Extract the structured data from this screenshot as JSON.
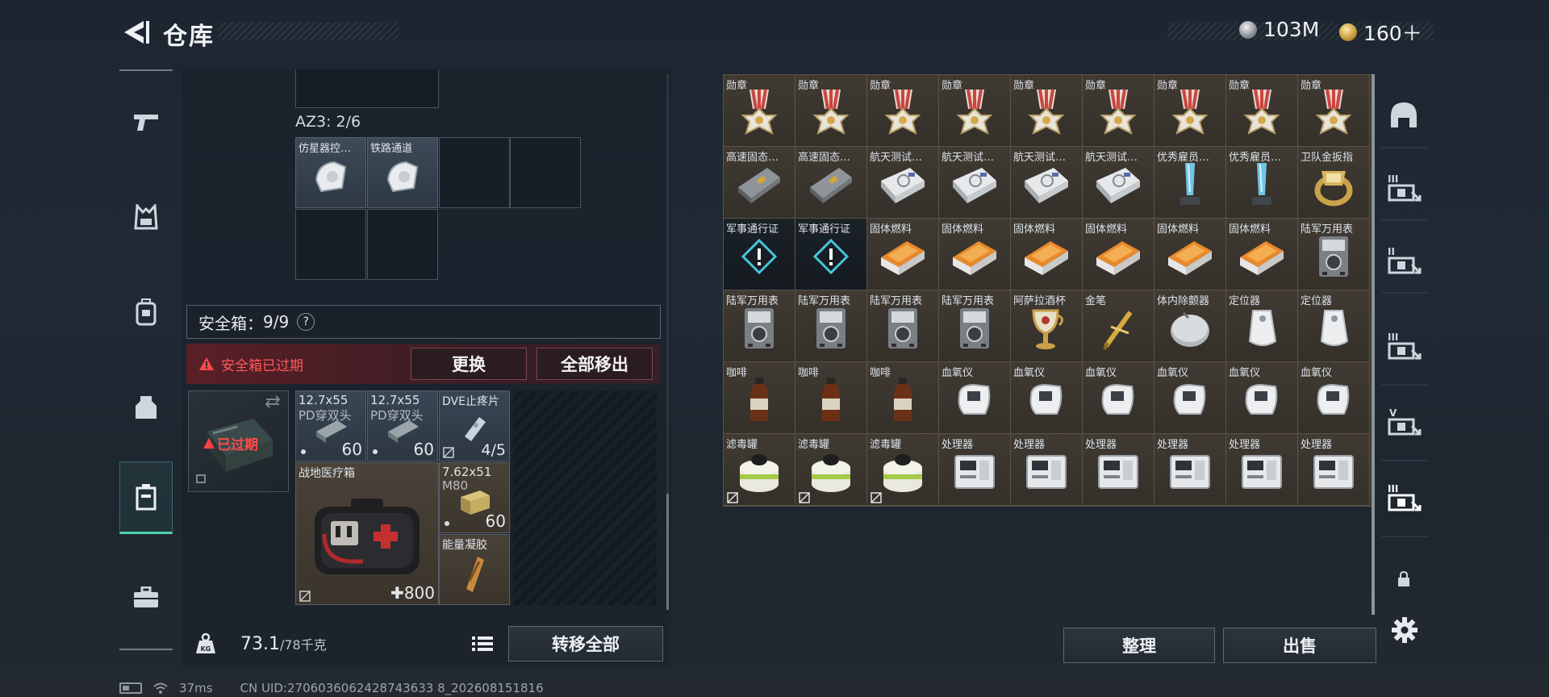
{
  "header": {
    "title": "仓库",
    "currency": [
      {
        "icon": "silver-coin-icon",
        "amount": "103M"
      },
      {
        "icon": "gold-coin-icon",
        "amount": "160＋"
      }
    ]
  },
  "left_nav": [
    {
      "icon": "pistol-icon",
      "active": false
    },
    {
      "icon": "vest-icon",
      "active": false
    },
    {
      "icon": "backpack-icon",
      "active": false
    },
    {
      "icon": "rig-icon",
      "active": false
    },
    {
      "icon": "safebox-icon",
      "active": true
    },
    {
      "icon": "toolbox-icon",
      "active": false
    }
  ],
  "container": {
    "section_label": "AZ3: 2/6",
    "items": [
      {
        "label": "仿星器控…",
        "icon": "device-icon"
      },
      {
        "label": "铁路通道",
        "icon": "device-icon"
      }
    ]
  },
  "safebox": {
    "title": "安全箱：",
    "count": "9/9",
    "help": "?",
    "warning": "安全箱已过期",
    "expired_stamp": "已过期",
    "replace_label": "更换",
    "move_all_label": "全部移出",
    "items": [
      {
        "label": "12.7x55",
        "sub": "PD穿双头",
        "count": "60"
      },
      {
        "label": "12.7x55",
        "sub": "PD穿双头",
        "count": "60"
      },
      {
        "label": "DVE止疼片",
        "count": "4/5"
      },
      {
        "label": "战地医疗箱",
        "count": "800"
      },
      {
        "label": "7.62x51",
        "sub": "M80",
        "count": "60"
      },
      {
        "label": "能量凝胶"
      }
    ]
  },
  "footer": {
    "weight_current": "73.1",
    "weight_max": "/78千克",
    "transfer_all_label": "转移全部",
    "sort_label": "整理",
    "sell_label": "出售"
  },
  "warehouse": {
    "rows": [
      [
        {
          "label": "勋章",
          "icon": "medal"
        },
        {
          "label": "勋章",
          "icon": "medal"
        },
        {
          "label": "勋章",
          "icon": "medal"
        },
        {
          "label": "勋章",
          "icon": "medal"
        },
        {
          "label": "勋章",
          "icon": "medal"
        },
        {
          "label": "勋章",
          "icon": "medal"
        },
        {
          "label": "勋章",
          "icon": "medal"
        },
        {
          "label": "勋章",
          "icon": "medal"
        },
        {
          "label": "勋章",
          "icon": "medal"
        }
      ],
      [
        {
          "label": "高速固态…",
          "icon": "ssd"
        },
        {
          "label": "高速固态…",
          "icon": "ssd"
        },
        {
          "label": "航天测试…",
          "icon": "tester"
        },
        {
          "label": "航天测试…",
          "icon": "tester"
        },
        {
          "label": "航天测试…",
          "icon": "tester"
        },
        {
          "label": "航天测试…",
          "icon": "tester"
        },
        {
          "label": "优秀雇员…",
          "icon": "trophy"
        },
        {
          "label": "优秀雇员…",
          "icon": "trophy"
        },
        {
          "label": "卫队金扳指",
          "icon": "ring"
        }
      ],
      [
        {
          "label": "军事通行证",
          "icon": "pass",
          "dark": true
        },
        {
          "label": "军事通行证",
          "icon": "pass",
          "dark": true
        },
        {
          "label": "固体燃料",
          "icon": "fuel"
        },
        {
          "label": "固体燃料",
          "icon": "fuel"
        },
        {
          "label": "固体燃料",
          "icon": "fuel"
        },
        {
          "label": "固体燃料",
          "icon": "fuel"
        },
        {
          "label": "固体燃料",
          "icon": "fuel"
        },
        {
          "label": "固体燃料",
          "icon": "fuel"
        },
        {
          "label": "陆军万用表",
          "icon": "meter"
        }
      ],
      [
        {
          "label": "陆军万用表",
          "icon": "meter"
        },
        {
          "label": "陆军万用表",
          "icon": "meter"
        },
        {
          "label": "陆军万用表",
          "icon": "meter"
        },
        {
          "label": "陆军万用表",
          "icon": "meter"
        },
        {
          "label": "阿萨拉酒杯",
          "icon": "cup"
        },
        {
          "label": "金笔",
          "icon": "pen"
        },
        {
          "label": "体内除颤器",
          "icon": "disc"
        },
        {
          "label": "定位器",
          "icon": "tag"
        },
        {
          "label": "定位器",
          "icon": "tag"
        }
      ],
      [
        {
          "label": "咖啡",
          "icon": "bottle"
        },
        {
          "label": "咖啡",
          "icon": "bottle"
        },
        {
          "label": "咖啡",
          "icon": "bottle"
        },
        {
          "label": "血氧仪",
          "icon": "oxi"
        },
        {
          "label": "血氧仪",
          "icon": "oxi"
        },
        {
          "label": "血氧仪",
          "icon": "oxi"
        },
        {
          "label": "血氧仪",
          "icon": "oxi"
        },
        {
          "label": "血氧仪",
          "icon": "oxi"
        },
        {
          "label": "血氧仪",
          "icon": "oxi"
        }
      ],
      [
        {
          "label": "滤毒罐",
          "icon": "filter",
          "broken": true
        },
        {
          "label": "滤毒罐",
          "icon": "filter",
          "broken": true
        },
        {
          "label": "滤毒罐",
          "icon": "filter",
          "broken": true
        },
        {
          "label": "处理器",
          "icon": "cpu"
        },
        {
          "label": "处理器",
          "icon": "cpu"
        },
        {
          "label": "处理器",
          "icon": "cpu"
        },
        {
          "label": "处理器",
          "icon": "cpu"
        },
        {
          "label": "处理器",
          "icon": "cpu"
        },
        {
          "label": "处理器",
          "icon": "cpu"
        }
      ]
    ]
  },
  "right_tabs": [
    {
      "icon": "helmet-icon"
    },
    {
      "icon": "storage-tab-1-icon",
      "badge": "III"
    },
    {
      "icon": "storage-tab-2-icon",
      "badge": "II"
    },
    {
      "icon": "storage-tab-3-icon",
      "badge": "III"
    },
    {
      "icon": "storage-tab-4-icon",
      "badge": "V"
    },
    {
      "icon": "storage-tab-5-icon",
      "badge": "III"
    },
    {
      "icon": "lock-icon"
    },
    {
      "icon": "gear-icon"
    }
  ],
  "status_bar": {
    "ping": "37ms",
    "uid": "CN UID:2706036062428743633 8_202608151816"
  },
  "colors": {
    "accent": "#4fd0b0",
    "danger": "#ff5a5a",
    "grid_bg": "#3a352f"
  }
}
